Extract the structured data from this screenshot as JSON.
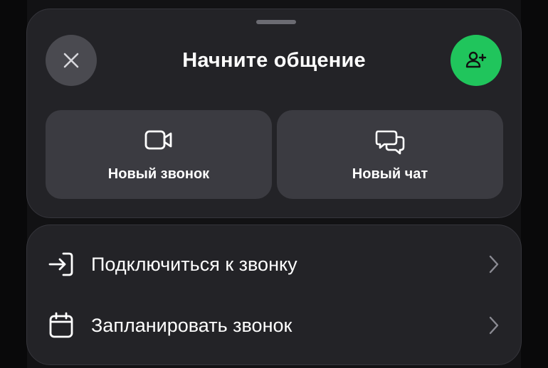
{
  "sheet": {
    "title": "Начните общение",
    "close_icon": "close-icon",
    "add_contact_icon": "add-person-icon",
    "accent_color": "#20c55c"
  },
  "actions": [
    {
      "label": "Новый звонок",
      "icon": "video-camera-icon"
    },
    {
      "label": "Новый чат",
      "icon": "chat-bubbles-icon"
    }
  ],
  "list": [
    {
      "label": "Подключиться к звонку",
      "icon": "sign-in-arrow-icon"
    },
    {
      "label": "Запланировать звонок",
      "icon": "calendar-icon"
    }
  ]
}
